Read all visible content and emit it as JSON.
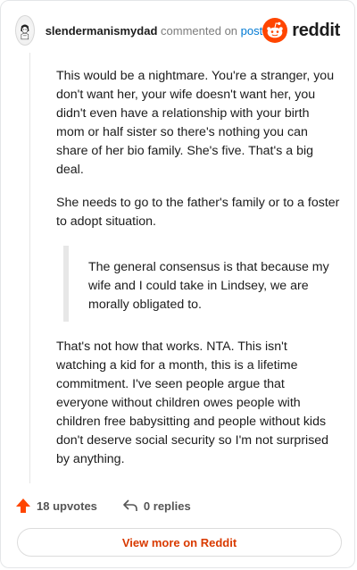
{
  "header": {
    "username": "slendermanismydad",
    "commented_on": "commented on",
    "post_link": "post",
    "brand": "reddit"
  },
  "comment": {
    "paragraphs": [
      "This would be a nightmare. You're a stranger, you don't want her, your wife doesn't want her, you didn't even have a relationship with your birth mom or half sister so there's nothing you can share of her bio family. She's five. That's a big deal.",
      "She needs to go to the father's family or to a foster to adopt situation."
    ],
    "quote": "The general consensus is that because my wife and I could take in Lindsey, we are morally obligated to.",
    "closing": "That's not how that works. NTA. This isn't watching a kid for a month, this is a lifetime commitment. I've seen people argue that everyone without children owes people with children free babysitting and people without kids don't deserve social security so I'm not surprised by anything."
  },
  "footer": {
    "upvotes": "18 upvotes",
    "replies": "0 replies",
    "view_more": "View more on Reddit"
  },
  "colors": {
    "accent": "#ff4500",
    "link": "#0079d3",
    "view_more": "#d93a00"
  },
  "icons": [
    "avatar",
    "reddit-logo-icon",
    "upvote-arrow-icon",
    "reply-arrow-icon"
  ]
}
